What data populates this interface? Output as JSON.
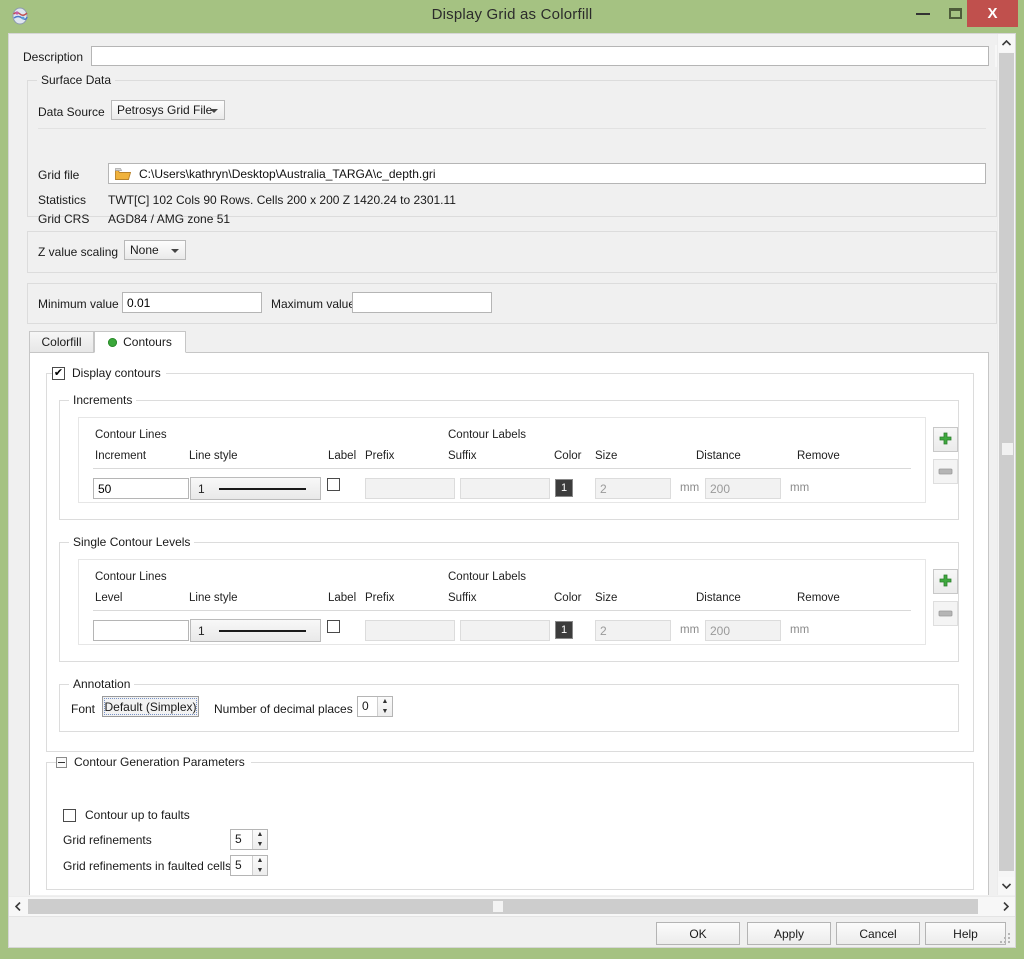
{
  "window": {
    "title": "Display Grid as Colorfill",
    "app_icon": "petrosys-globe-icon",
    "minimize_label": "Minimize",
    "maximize_label": "Maximize",
    "close_label": "X",
    "titlebar_color": "#a5c282",
    "close_button_color": "#c0504d"
  },
  "description": {
    "label": "Description",
    "value": "",
    "placeholder": ""
  },
  "surface_data": {
    "title": "Surface Data",
    "data_source_label": "Data Source",
    "data_source_value": "Petrosys Grid File",
    "grid_file_label": "Grid file",
    "grid_file_value": "C:\\Users\\kathryn\\Desktop\\Australia_TARGA\\c_depth.gri",
    "statistics_label": "Statistics",
    "statistics_value": "TWT[C] 102 Cols 90 Rows. Cells 200 x 200 Z 1420.24 to 2301.11",
    "grid_crs_label": "Grid CRS",
    "grid_crs_value": "AGD84 / AMG zone 51"
  },
  "z_value_scaling": {
    "label": "Z value scaling",
    "value": "None"
  },
  "range": {
    "minimum_label": "Minimum value",
    "minimum_value": "0.01",
    "maximum_label": "Maximum value",
    "maximum_value": ""
  },
  "tabs": [
    {
      "label": "Colorfill",
      "active": false,
      "has_dot": false
    },
    {
      "label": "Contours",
      "active": true,
      "has_dot": true,
      "dot_color": "#3aa83a"
    }
  ],
  "display_contours": {
    "label": "Display contours",
    "checked": true,
    "check_glyph": "✔"
  },
  "increments": {
    "title": "Increments",
    "group_header_lines": "Contour Lines",
    "group_header_labels": "Contour Labels",
    "columns": [
      "Increment",
      "Line style",
      "Label",
      "Prefix",
      "Suffix",
      "Color",
      "Size",
      "Distance",
      "Remove"
    ],
    "row": {
      "increment": "50",
      "line_style_number": "1",
      "label_checked": false,
      "prefix": "",
      "suffix": "",
      "color_swatch_text": "1",
      "color_swatch_color": "#3c3c3c",
      "size": "2",
      "size_unit": "mm",
      "distance": "200",
      "distance_unit": "mm"
    },
    "add_button": "add-row",
    "remove_button": "remove-row"
  },
  "single_contour_levels": {
    "title": "Single Contour Levels",
    "group_header_lines": "Contour Lines",
    "group_header_labels": "Contour Labels",
    "columns": [
      "Level",
      "Line style",
      "Label",
      "Prefix",
      "Suffix",
      "Color",
      "Size",
      "Distance",
      "Remove"
    ],
    "row": {
      "level": "",
      "line_style_number": "1",
      "label_checked": false,
      "prefix": "",
      "suffix": "",
      "color_swatch_text": "1",
      "color_swatch_color": "#3c3c3c",
      "size": "2",
      "size_unit": "mm",
      "distance": "200",
      "distance_unit": "mm"
    },
    "add_button": "add-row",
    "remove_button": "remove-row"
  },
  "annotation": {
    "title": "Annotation",
    "font_label": "Font",
    "font_value": "Default (Simplex)",
    "decimals_label": "Number of decimal places",
    "decimals_value": "0"
  },
  "contour_generation": {
    "title": "Contour Generation Parameters",
    "expanded": true,
    "contour_up_to_faults_label": "Contour up to faults",
    "contour_up_to_faults_checked": false,
    "grid_refinements_label": "Grid refinements",
    "grid_refinements_value": "5",
    "grid_refinements_faulted_label": "Grid refinements in faulted cells",
    "grid_refinements_faulted_value": "5"
  },
  "buttons": {
    "ok": "OK",
    "apply": "Apply",
    "cancel": "Cancel",
    "help": "Help"
  },
  "scrollbars": {
    "vertical_up": "▲",
    "vertical_down": "▼",
    "horizontal_left": "‹",
    "horizontal_right": "›",
    "description_up": "▲"
  }
}
